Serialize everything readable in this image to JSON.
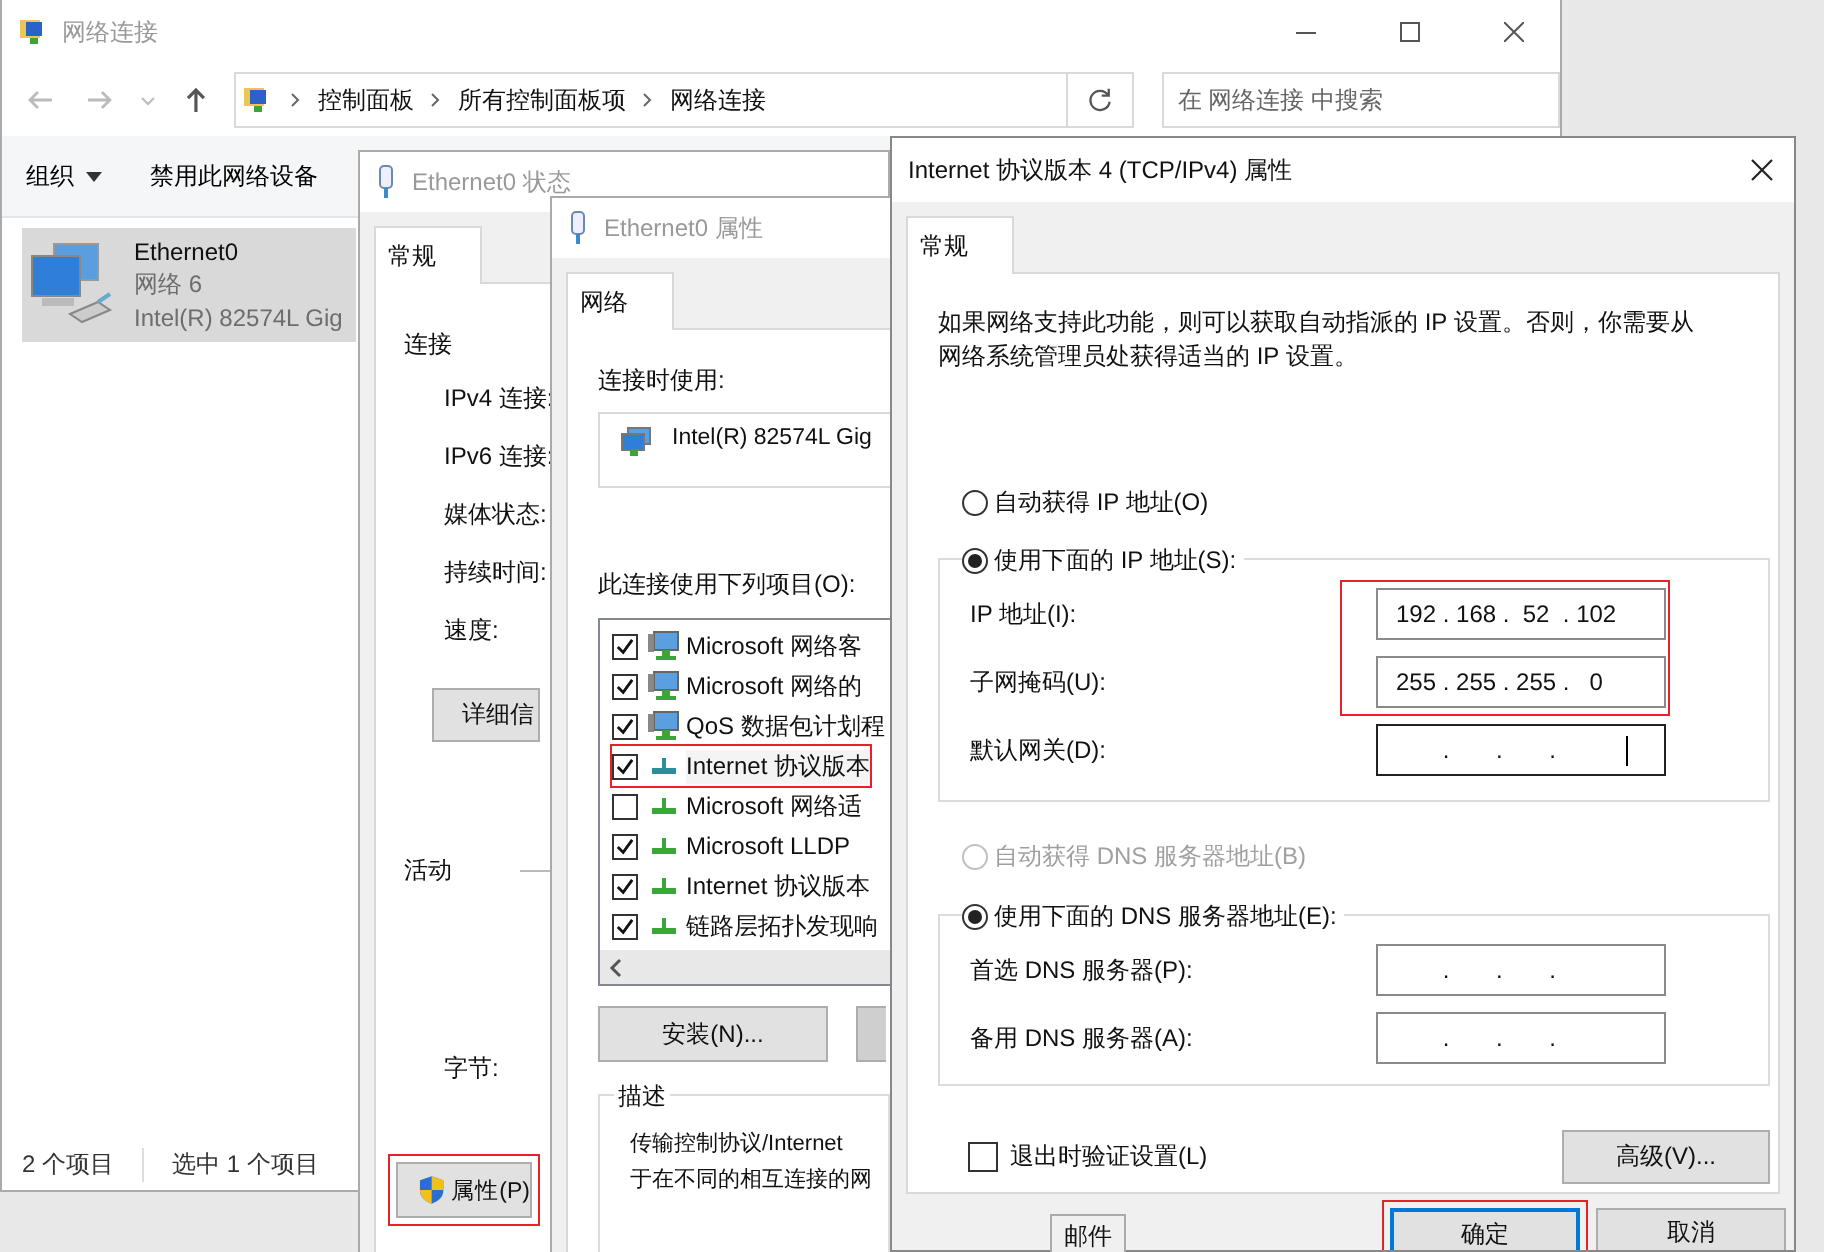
{
  "explorer": {
    "title": "网络连接",
    "breadcrumb": [
      "控制面板",
      "所有控制面板项",
      "网络连接"
    ],
    "search": {
      "placeholder": "在 网络连接 中搜索"
    },
    "toolbar": [
      {
        "label": "组织",
        "dropdown": true
      },
      {
        "label": "禁用此网络设备",
        "dropdown": false
      }
    ],
    "items": [
      {
        "name": "Ethernet0",
        "network": "网络 6",
        "adapter": "Intel(R) 82574L Gig",
        "selected": true
      }
    ],
    "status_bar": [
      "2 个项目",
      "选中 1 个项目"
    ]
  },
  "status_dialog": {
    "title": "Ethernet0 状态",
    "tabs": [
      {
        "label": "常规",
        "selected": true
      }
    ],
    "connection_heading": "连接",
    "fields": [
      "IPv4 连接:",
      "IPv6 连接:",
      "媒体状态:",
      "持续时间:",
      "速度:"
    ],
    "details_button": "详细信",
    "activity_heading": "活动",
    "bytes_label": "字节:",
    "properties_button": {
      "label": "属性(P)",
      "annotated": true
    }
  },
  "properties_dialog": {
    "title": "Ethernet0 属性",
    "tabs": [
      {
        "label": "网络",
        "selected": true
      }
    ],
    "connect_using_label": "连接时使用:",
    "adapter": "Intel(R) 82574L Gig",
    "items_label": "此连接使用下列项目(O):",
    "items": [
      {
        "label": "Microsoft 网络客",
        "checked": true,
        "kind": "client",
        "annotated": false
      },
      {
        "label": "Microsoft 网络的",
        "checked": true,
        "kind": "client",
        "annotated": false
      },
      {
        "label": "QoS 数据包计划程",
        "checked": true,
        "kind": "client",
        "annotated": false
      },
      {
        "label": "Internet 协议版本",
        "checked": true,
        "kind": "selected-protocol",
        "annotated": true
      },
      {
        "label": "Microsoft 网络适",
        "checked": false,
        "kind": "protocol",
        "annotated": false
      },
      {
        "label": "Microsoft LLDP",
        "checked": true,
        "kind": "protocol",
        "annotated": false
      },
      {
        "label": "Internet 协议版本",
        "checked": true,
        "kind": "protocol",
        "annotated": false
      },
      {
        "label": "链路层拓扑发现响",
        "checked": true,
        "kind": "protocol",
        "annotated": false
      }
    ],
    "buttons": [
      {
        "kind": "text",
        "label": "安装(N)..."
      },
      {
        "kind": "blank"
      }
    ],
    "description_heading": "描述",
    "description": "传输控制协议/Internet\n于在不同的相互连接的网"
  },
  "ipv4_dialog": {
    "title": "Internet 协议版本 4 (TCP/IPv4) 属性",
    "tabs": [
      {
        "label": "常规",
        "selected": true
      }
    ],
    "intro": "如果网络支持此功能，则可以获取自动指派的 IP 设置。否则，你需要从网络系统管理员处获得适当的 IP 设置。",
    "ip_options": [
      {
        "label": "自动获得 IP 地址(O)",
        "selected": false,
        "disabled": false
      },
      {
        "label": "使用下面的 IP 地址(S):",
        "selected": true,
        "disabled": false
      }
    ],
    "ip_fields": [
      {
        "label": "IP 地址(I):",
        "value": "192 . 168 .  52  . 102",
        "focused": false
      },
      {
        "label": "子网掩码(U):",
        "value": "255 . 255 . 255 .   0",
        "focused": false
      },
      {
        "label": "默认网关(D):",
        "value": "       .       .       .",
        "focused": true
      }
    ],
    "ip_annotated": true,
    "dns_options": [
      {
        "label": "自动获得 DNS 服务器地址(B)",
        "selected": false,
        "disabled": true
      },
      {
        "label": "使用下面的 DNS 服务器地址(E):",
        "selected": true,
        "disabled": false
      }
    ],
    "dns_fields": [
      {
        "label": "首选 DNS 服务器(P):",
        "value": "       .       .       .",
        "focused": false
      },
      {
        "label": "备用 DNS 服务器(A):",
        "value": "       .       .       .",
        "focused": false
      }
    ],
    "validate": {
      "label": "退出时验证设置(L)",
      "checked": false
    },
    "advanced_button": "高级(V)...",
    "buttons": [
      {
        "label": "确定",
        "default": true,
        "annotated": true
      },
      {
        "label": "取消",
        "default": false,
        "annotated": false
      }
    ]
  },
  "background_tab": "邮件"
}
